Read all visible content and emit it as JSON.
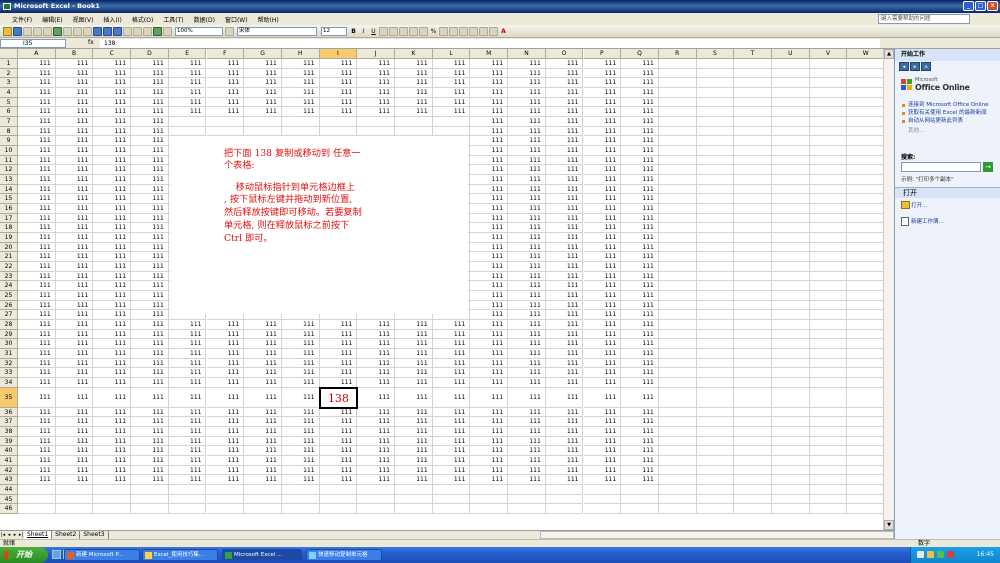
{
  "window": {
    "title": "Microsoft Excel - Book1",
    "min_symbol": "_",
    "max_symbol": "□",
    "close_symbol": "x"
  },
  "menu": [
    "文件(F)",
    "编辑(E)",
    "视图(V)",
    "插入(I)",
    "格式(O)",
    "工具(T)",
    "数据(D)",
    "窗口(W)",
    "帮助(H)"
  ],
  "help_box": {
    "placeholder": "键入需要帮助的问题"
  },
  "toolbar": {
    "zoom": "100%",
    "font_name": "宋体",
    "font_size": "12",
    "bold": "B",
    "italic": "I",
    "underline": "U",
    "percent": "%",
    "font_color_glyph": "A"
  },
  "formula_bar": {
    "name_box": "I35",
    "fx": "fx",
    "value": "138"
  },
  "columns": [
    "A",
    "B",
    "C",
    "D",
    "E",
    "F",
    "G",
    "H",
    "I",
    "J",
    "K",
    "L",
    "M",
    "N",
    "O",
    "P",
    "Q",
    "R",
    "S",
    "T",
    "U",
    "V",
    "W"
  ],
  "selected_column": "I",
  "selected_row": 35,
  "cell_value": "111",
  "selected_value": "138",
  "note": {
    "line1": "把下面 138 复制或移动到 任意一",
    "line2": "个表格:",
    "line3": "    移动鼠标指针到单元格边框上",
    "line4": ", 按下鼠标左键并拖动到新位置,",
    "line5": "然后释放按键即可移动。若要复制",
    "line6": "单元格, 则在释放鼠标之前按下",
    "line7": "Ctrl 即可。"
  },
  "sheet_tabs": [
    "Sheet1",
    "Sheet2",
    "Sheet3"
  ],
  "tab_nav": [
    "|◂",
    "◂",
    "▸",
    "▸|"
  ],
  "status": {
    "left": "就绪",
    "right": "数字"
  },
  "task_pane": {
    "title": "开始工作",
    "nav": [
      "◂",
      "▸",
      "⌂"
    ],
    "office_brand": "Microsoft",
    "office_name": "Office Online",
    "links": [
      "连接到 Microsoft Office Online",
      "获取有关使用 Excel 的最新新闻",
      "自动从网站更新此列表"
    ],
    "more": "其他...",
    "search_label": "搜索:",
    "search_go": "→",
    "example": "示例: \"打印多个副本\"",
    "open_header": "打开",
    "open_link": "打开...",
    "new_workbook": "新建工作簿..."
  },
  "taskbar": {
    "start": "开始",
    "tasks": [
      "新建 Microsoft P...",
      "Excel_使用技巧集...",
      "Microsoft Excel ...",
      "快速移动复制单元格"
    ],
    "clock": "16:45"
  }
}
